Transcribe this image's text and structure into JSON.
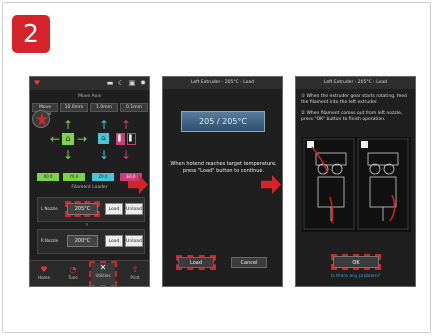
{
  "step_badge": "2",
  "phone1": {
    "move_axis_title": "Move Axis",
    "move_steps": [
      "Move Steps",
      "10.0mm",
      "1.0mm",
      "0.1mm"
    ],
    "chips": [
      "X0.0",
      "Y0.0",
      "Z0.0",
      "E0.0"
    ],
    "filament_loader_title": "Filament Loader",
    "left_extruder": {
      "label": "L.Nozzle",
      "temp": "205°C",
      "load": "Load",
      "unload": "Unload"
    },
    "right_extruder": {
      "label": "R.Nozzle",
      "temp": "200°C",
      "load": "Load",
      "unload": "Unload"
    },
    "nav": [
      {
        "icon": "heart-icon",
        "glyph": "♥",
        "label": "Home"
      },
      {
        "icon": "gauge-icon",
        "glyph": "◔",
        "label": "Tune"
      },
      {
        "icon": "tools-icon",
        "glyph": "✕",
        "label": "Utilities"
      },
      {
        "icon": "print-icon",
        "glyph": "⇧",
        "label": "Print"
      }
    ]
  },
  "phone2": {
    "header": "Left Extruder - 205°C - Load",
    "temp_display": "205 / 205°C",
    "message": "When hotend reaches target temperature, press \"Load\" button to continue.",
    "load": "Load",
    "cancel": "Cancel"
  },
  "phone3": {
    "header": "Left Extruder - 205°C - Load",
    "instruction1": "① When the extruder gear starts rotating, feed the filament into the left extruder.",
    "instruction2": "② When filament comes out from left nozzle, press \"OK\" button to finish operation.",
    "ok": "OK",
    "help_link": "Is there any problem?"
  },
  "colors": {
    "accent": "#d5232a",
    "screen_bg": "#1f1f1f",
    "green": "#7fd34a",
    "cyan": "#4ac4d8"
  }
}
